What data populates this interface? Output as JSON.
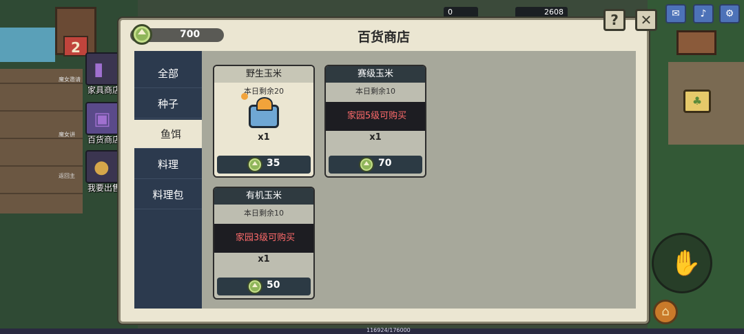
{
  "shop": {
    "title": "百货商店",
    "currency": "700",
    "help_label": "?",
    "close_label": "✕"
  },
  "tabs": [
    {
      "label": "全部"
    },
    {
      "label": "种子"
    },
    {
      "label": "鱼饵"
    },
    {
      "label": "料理"
    },
    {
      "label": "料理包"
    }
  ],
  "active_tab": "鱼饵",
  "cards": [
    {
      "name": "野生玉米",
      "remain": "本日剩余20",
      "qty": "x1",
      "price": "35",
      "locked": false,
      "lock_text": ""
    },
    {
      "name": "赛级玉米",
      "remain": "本日剩余10",
      "qty": "x1",
      "price": "70",
      "locked": true,
      "lock_text": "家园5级可购买"
    },
    {
      "name": "有机玉米",
      "remain": "本日剩余10",
      "qty": "x1",
      "price": "50",
      "locked": true,
      "lock_text": "家园3级可购买"
    }
  ],
  "side_menu": [
    {
      "label": "家具商店",
      "icon": "wardrobe-icon"
    },
    {
      "label": "百货商店",
      "icon": "chest-icon"
    },
    {
      "label": "我要出售",
      "icon": "coins-icon"
    }
  ],
  "side_small": [
    "魔女邀请",
    "魔女讲",
    "返回主"
  ],
  "hud": {
    "res1": "0",
    "res2": "2608",
    "hut_level": "2"
  },
  "footer": {
    "exp": "116924/176000"
  },
  "colors": {
    "accent_red": "#ff6b6b",
    "tab_bg": "#2c3a4e",
    "panel_bg": "#ebe6d2"
  }
}
